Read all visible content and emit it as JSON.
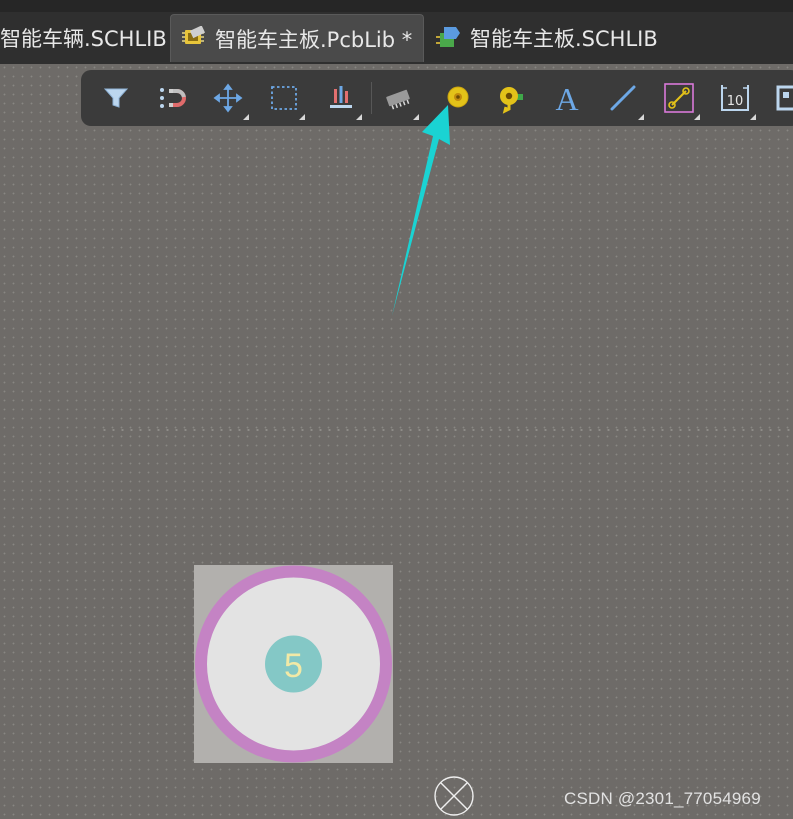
{
  "tabs": [
    {
      "label": "智能车辆.SCHLIB"
    },
    {
      "label": "智能车主板.PcbLib *",
      "active": true
    },
    {
      "label": "智能车主板.SCHLIB"
    }
  ],
  "toolbar": {
    "buttons": [
      {
        "name": "filter",
        "icon": "filter-icon"
      },
      {
        "name": "snap",
        "icon": "magnet-icon"
      },
      {
        "name": "move",
        "icon": "move-arrows-icon"
      },
      {
        "name": "select",
        "icon": "dashed-rectangle-icon"
      },
      {
        "name": "align",
        "icon": "align-icon"
      },
      {
        "name": "component",
        "icon": "ic-chip-icon"
      },
      {
        "name": "place-pad",
        "icon": "pad-icon"
      },
      {
        "name": "place-via",
        "icon": "via-icon"
      },
      {
        "name": "place-string",
        "icon": "text-a-icon"
      },
      {
        "name": "place-line",
        "icon": "line-icon"
      },
      {
        "name": "interactive-routing",
        "icon": "route-icon"
      },
      {
        "name": "dimension",
        "icon": "dimension-icon"
      },
      {
        "name": "more",
        "icon": "rectangle-icon"
      }
    ]
  },
  "pad": {
    "designator": "5"
  },
  "watermark": "CSDN @2301_77054969",
  "colors": {
    "canvas": "#6e6b68",
    "pad_ring": "#c483c4",
    "pad_body": "#e3e3e3",
    "hole": "#84c8c6",
    "annotation_arrow": "#1ad3d3"
  }
}
